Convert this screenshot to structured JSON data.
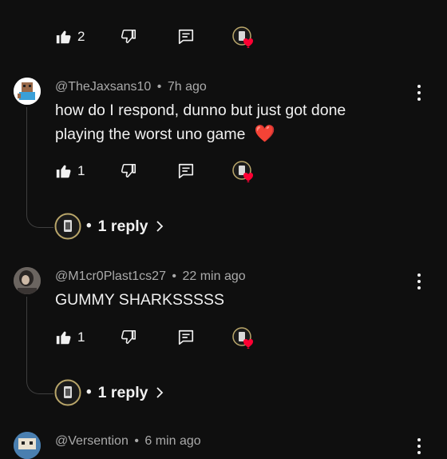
{
  "top_actions": {
    "like_count": "2"
  },
  "comments": [
    {
      "handle": "@TheJaxsans10",
      "time": "7h ago",
      "lines": [
        "how do I respond, dunno but just got done",
        "playing the worst uno game"
      ],
      "emoji": "❤️",
      "like_count": "1",
      "reply_label": "1 reply",
      "reply_dot": "•"
    },
    {
      "handle": "@M1cr0Plast1cs27",
      "time": "22 min ago",
      "lines": [
        "GUMMY SHARKSSSSS"
      ],
      "like_count": "1",
      "reply_label": "1 reply",
      "reply_dot": "•"
    },
    {
      "handle": "@Versention",
      "time": "6 min ago"
    }
  ],
  "separator": "•",
  "icons": [
    "thumbs-up-icon",
    "thumbs-down-icon",
    "reply-icon",
    "creator-heart-icon",
    "more-icon",
    "chevron-right-icon"
  ],
  "colors": {
    "background": "#0f0f0f",
    "text": "#f1f1f1",
    "muted": "#aaaaaa",
    "heart": "#ff0033"
  }
}
